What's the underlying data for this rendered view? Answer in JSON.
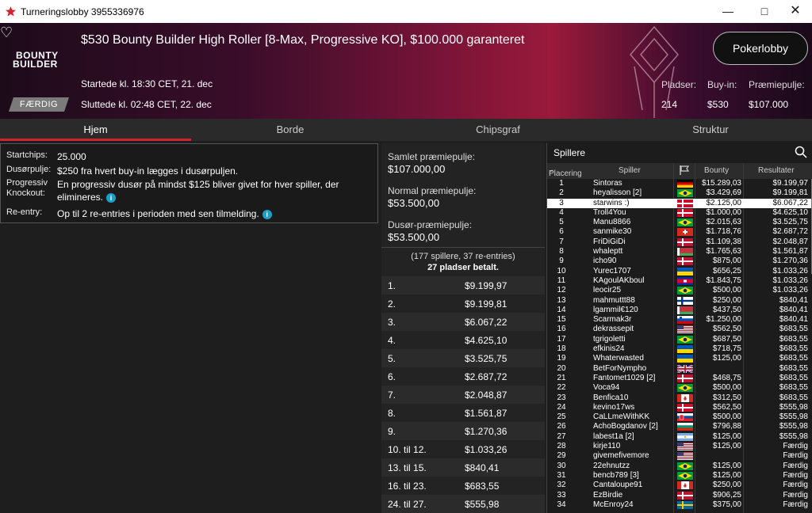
{
  "window": {
    "title": "Turneringslobby 3955336976"
  },
  "banner": {
    "tournament_name": "$530 Bounty Builder High Roller [8-Max, Progressive KO], $100.000 garanteret",
    "logo_line1": "BOUNTY",
    "logo_line2": "BUILDER",
    "started": "Startede kl. 18:30 CET, 21. dec",
    "ended": "Sluttede kl. 02:48 CET, 22. dec",
    "status": "FÆRDIG",
    "lobby_button": "Pokerlobby",
    "seats_label": "Pladser:",
    "seats_value": "214",
    "buyin_label": "Buy-in:",
    "buyin_value": "$530",
    "prize_label": "Præmiepulje:",
    "prize_value": "$107.000"
  },
  "tabs": [
    "Hjem",
    "Borde",
    "Chipsgraf",
    "Struktur"
  ],
  "info": {
    "startchips_k": "Startchips:",
    "startchips_v": "25.000",
    "dusor_k": "Dusørpulje:",
    "dusor_v": "$250 fra hvert buy-in lægges i dusørpuljen.",
    "prog_k": "Progressiv Knockout:",
    "prog_v": "En progressiv dusør på mindst $125 bliver givet for hver spiller, der elimineres.",
    "reentry_k": "Re-entry:",
    "reentry_v": "Op til 2 re-entries i perioden med sen tilmelding."
  },
  "prizepool": {
    "total_label": "Samlet præmiepulje:",
    "total_value": "$107.000,00",
    "normal_label": "Normal præmiepulje:",
    "normal_value": "$53.500,00",
    "bounty_label": "Dusør-præmiepulje:",
    "bounty_value": "$53.500,00",
    "players_line": "(177 spillere, 37 re-entries)",
    "paid_line": "27 pladser betalt.",
    "payouts": [
      {
        "p": "1.",
        "a": "$9.199,97"
      },
      {
        "p": "2.",
        "a": "$9.199,81"
      },
      {
        "p": "3.",
        "a": "$6.067,22"
      },
      {
        "p": "4.",
        "a": "$4.625,10"
      },
      {
        "p": "5.",
        "a": "$3.525,75"
      },
      {
        "p": "6.",
        "a": "$2.687,72"
      },
      {
        "p": "7.",
        "a": "$2.048,87"
      },
      {
        "p": "8.",
        "a": "$1.561,87"
      },
      {
        "p": "9.",
        "a": "$1.270,36"
      },
      {
        "p": "10. til 12.",
        "a": "$1.033,26"
      },
      {
        "p": "13. til 15.",
        "a": "$840,41"
      },
      {
        "p": "16. til 23.",
        "a": "$683,55"
      },
      {
        "p": "24. til 27.",
        "a": "$555,98"
      }
    ]
  },
  "players": {
    "header": "Spillere",
    "col_place": "Placering",
    "col_player": "Spiller",
    "col_bounty": "Bounty",
    "col_result": "Resultater",
    "rows": [
      {
        "n": "1",
        "name": "Sintoras",
        "flag": "de",
        "b": "$15.289,03",
        "r": "$9.199,97"
      },
      {
        "n": "2",
        "name": "heyalisson [2]",
        "flag": "br",
        "b": "$3.429,69",
        "r": "$9.199,81"
      },
      {
        "n": "3",
        "name": "starwins :)",
        "flag": "dk",
        "b": "$2.125,00",
        "r": "$6.067,22",
        "hl": true
      },
      {
        "n": "4",
        "name": "Troll4You",
        "flag": "dk",
        "b": "$1.000,00",
        "r": "$4.625,10"
      },
      {
        "n": "5",
        "name": "Manu8866",
        "flag": "br",
        "b": "$2.015,63",
        "r": "$3.525,75"
      },
      {
        "n": "6",
        "name": "sanmike30",
        "flag": "ch",
        "b": "$1.718,76",
        "r": "$2.687,72"
      },
      {
        "n": "7",
        "name": "FriDiGiDi",
        "flag": "dk",
        "b": "$1.109,38",
        "r": "$2.048,87"
      },
      {
        "n": "8",
        "name": "whaleptt",
        "flag": "by",
        "b": "$1.765,63",
        "r": "$1.561,87"
      },
      {
        "n": "9",
        "name": "icho90",
        "flag": "dk",
        "b": "$875,00",
        "r": "$1.270,36"
      },
      {
        "n": "10",
        "name": "Yurec1707",
        "flag": "ua",
        "b": "$656,25",
        "r": "$1.033,26"
      },
      {
        "n": "11",
        "name": "KAgoulAKboul",
        "flag": "kh",
        "b": "$1.843,75",
        "r": "$1.033,26"
      },
      {
        "n": "12",
        "name": "leocir25",
        "flag": "br",
        "b": "$500,00",
        "r": "$1.033,26"
      },
      {
        "n": "13",
        "name": "mahmuttt88",
        "flag": "fi",
        "b": "$250,00",
        "r": "$840,41"
      },
      {
        "n": "14",
        "name": "lgammil€120",
        "flag": "by",
        "b": "$437,50",
        "r": "$840,41"
      },
      {
        "n": "15",
        "name": "Scarmak3r",
        "flag": "si",
        "b": "$1.250,00",
        "r": "$840,41"
      },
      {
        "n": "16",
        "name": "dekrassepit",
        "flag": "us",
        "b": "$562,50",
        "r": "$683,55"
      },
      {
        "n": "17",
        "name": "tgrigoletti",
        "flag": "br",
        "b": "$687,50",
        "r": "$683,55"
      },
      {
        "n": "18",
        "name": "efkinis24",
        "flag": "ua",
        "b": "$718,75",
        "r": "$683,55"
      },
      {
        "n": "19",
        "name": "Whaterwasted",
        "flag": "ua",
        "b": "$125,00",
        "r": "$683,55"
      },
      {
        "n": "20",
        "name": "BetForNympho",
        "flag": "gb",
        "b": "",
        "r": "$683,55"
      },
      {
        "n": "21",
        "name": "Fantomet1029 [2]",
        "flag": "dk",
        "b": "$468,75",
        "r": "$683,55"
      },
      {
        "n": "22",
        "name": "Voca94",
        "flag": "br",
        "b": "$500,00",
        "r": "$683,55"
      },
      {
        "n": "23",
        "name": "Benfica10",
        "flag": "ca",
        "b": "$312,50",
        "r": "$683,55"
      },
      {
        "n": "24",
        "name": "kevino17ws",
        "flag": "dk",
        "b": "$562,50",
        "r": "$555,98"
      },
      {
        "n": "25",
        "name": "CaLLmeWithKK",
        "flag": "sk",
        "b": "$500,00",
        "r": "$555,98"
      },
      {
        "n": "26",
        "name": "AchoBogdanov [2]",
        "flag": "bg",
        "b": "$796,88",
        "r": "$555,98"
      },
      {
        "n": "27",
        "name": "labest1a [2]",
        "flag": "ar",
        "b": "$125,00",
        "r": "$555,98"
      },
      {
        "n": "28",
        "name": "kirje110",
        "flag": "us",
        "b": "$125,00",
        "r": "Færdig"
      },
      {
        "n": "29",
        "name": "givemefivemore",
        "flag": "us",
        "b": "",
        "r": "Færdig"
      },
      {
        "n": "30",
        "name": "22ehnutzz",
        "flag": "br",
        "b": "$125,00",
        "r": "Færdig"
      },
      {
        "n": "31",
        "name": "bencb789 [3]",
        "flag": "br",
        "b": "$125,00",
        "r": "Færdig"
      },
      {
        "n": "32",
        "name": "Cantaloupe91",
        "flag": "ca",
        "b": "$250,00",
        "r": "Færdig"
      },
      {
        "n": "33",
        "name": "EzBirdie",
        "flag": "dk",
        "b": "$906,25",
        "r": "Færdig"
      },
      {
        "n": "34",
        "name": "McEnroy24",
        "flag": "se",
        "b": "$375,00",
        "r": "Færdig"
      }
    ]
  }
}
